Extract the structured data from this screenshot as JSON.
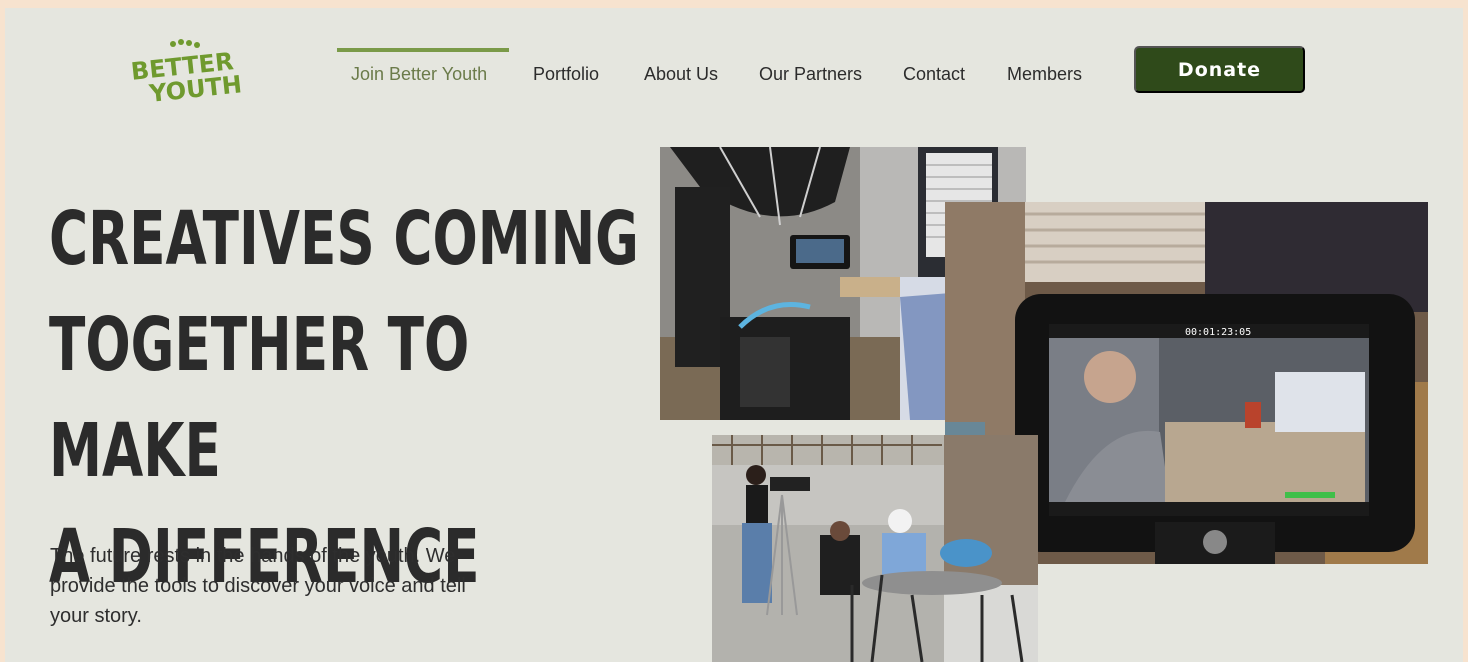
{
  "brand": {
    "logo_line1": "BETTER",
    "logo_line2": "YOUTH",
    "logo_color": "#6f9a2e"
  },
  "nav": {
    "items": [
      {
        "label": "Join Better Youth",
        "active": true
      },
      {
        "label": "Portfolio"
      },
      {
        "label": "About Us"
      },
      {
        "label": "Our Partners"
      },
      {
        "label": "Contact"
      },
      {
        "label": "Members"
      }
    ],
    "donate_label": "Donate"
  },
  "hero": {
    "headline": [
      "CREATIVES COMING",
      "TOGETHER TO MAKE",
      "A DIFFERENCE"
    ],
    "subtext": "The future rests in the hands of the youth. We provide the tools to discover your voice and tell your story."
  },
  "photos": {
    "monitor_timecode": "00:01:23:05"
  },
  "colors": {
    "accent": "#7a9a48",
    "button": "#2f4a1a",
    "background": "#e5e6df",
    "outer": "#f7e3cf"
  }
}
